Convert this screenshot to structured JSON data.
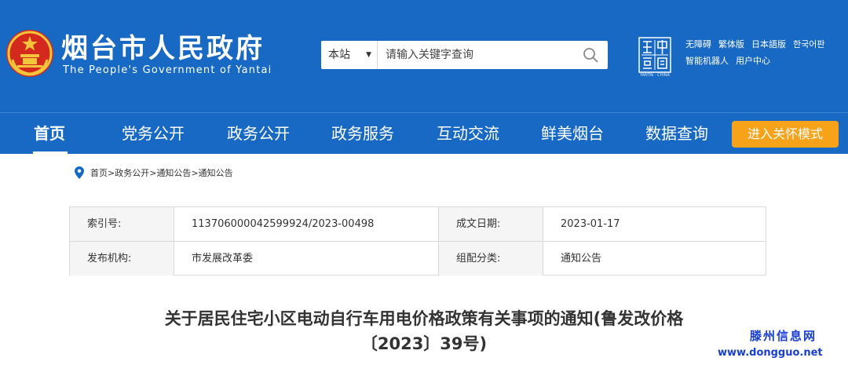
{
  "header": {
    "site_title": "烟台市人民政府",
    "site_subtitle": "The People's Government of Yantai",
    "search": {
      "scope_label": "本站",
      "placeholder": "请输入关键字查询"
    },
    "seal_caption": "YANTAI · CHINA",
    "quick_links_row1": [
      "无障碍",
      "繁体版",
      "日本語版",
      "한국어판"
    ],
    "quick_links_row2": [
      "智能机器人",
      "用户中心"
    ]
  },
  "nav": {
    "items": [
      "首页",
      "党务公开",
      "政务公开",
      "政务服务",
      "互动交流",
      "鲜美烟台",
      "数据查询"
    ],
    "active_index": 0,
    "care_mode_label": "进入关怀模式"
  },
  "breadcrumb": {
    "items": [
      "首页",
      "政务公开",
      "通知公告",
      "通知公告"
    ],
    "separator": ">"
  },
  "info_table": {
    "index_label": "索引号:",
    "index_value": "113706000042599924/2023-00498",
    "date_label": "成文日期:",
    "date_value": "2023-01-17",
    "org_label": "发布机构:",
    "org_value": "市发展改革委",
    "category_label": "组配分类:",
    "category_value": "通知公告"
  },
  "article": {
    "title_line1": "关于居民住宅小区电动自行车用电价格政策有关事项的通知(鲁发改价格",
    "title_line2": "〔2023〕39号)"
  },
  "watermark": {
    "cn": "滕州信息网",
    "en": "www.dongguo.net"
  },
  "colors": {
    "header_blue": "#1769c4",
    "care_orange": "#f6a31a",
    "watermark_blue": "#1a3fd0"
  }
}
